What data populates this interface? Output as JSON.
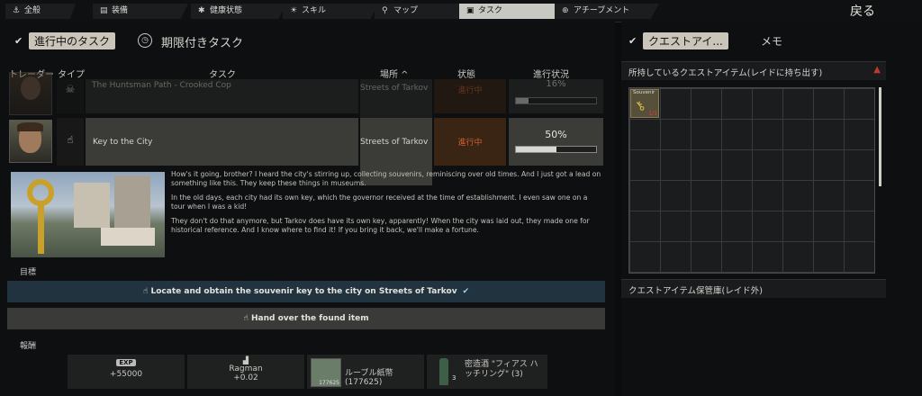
{
  "nav": {
    "tabs": [
      {
        "label": "全般",
        "icon": "anchor-icon"
      },
      {
        "label": "装備",
        "icon": "bag-icon"
      },
      {
        "label": "健康状態",
        "icon": "health-icon"
      },
      {
        "label": "スキル",
        "icon": "sun-icon"
      },
      {
        "label": "マップ",
        "icon": "map-pin-icon"
      },
      {
        "label": "タスク",
        "icon": "clipboard-icon"
      },
      {
        "label": "アチーブメント",
        "icon": "plus-circle-icon"
      }
    ],
    "back_label": "戻る"
  },
  "tasks": {
    "active_tab": "進行中のタスク",
    "timed_tab": "期限付きタスク",
    "headers": {
      "trader": "トレーダー",
      "type": "タイプ",
      "task": "タスク",
      "location": "場所 ^",
      "status": "状態",
      "progress": "進行状況"
    },
    "rows": [
      {
        "name": "The Huntsman Path - Crooked Cop",
        "location": "Streets of Tarkov",
        "status": "進行中",
        "progress_text": "16%",
        "progress": 0.16
      },
      {
        "name": "Key to the City",
        "location": "Streets of Tarkov",
        "status": "進行中",
        "progress_text": "50%",
        "progress": 0.5
      }
    ],
    "description": [
      "How's it going, brother? I heard the city's stirring up, collecting souvenirs, reminiscing over old times. And I just got a lead on something like this. They keep these things in museums.",
      "In the old days, each city had its own key, which the governor received at the time of establishment. I even saw one on a tour when I was a kid!",
      "They don't do that anymore, but Tarkov does have its own key, apparently! When the city was laid out, they made one for historical reference. And I know where to find it! If you bring it back, we'll make a fortune."
    ],
    "objectives_label": "目標",
    "objectives": [
      "Locate and obtain the souvenir key to the city on Streets of Tarkov",
      "Hand over the found item"
    ],
    "rewards_label": "報酬",
    "rewards": {
      "exp_badge": "EXP",
      "exp_value": "+55000",
      "trader_name": "Ragman",
      "trader_value": "+0.02",
      "item1_label": "ルーブル紙幣 (177625)",
      "item1_count": "177625",
      "item2_label": "密造酒 \"フィアス ハッチリング\" (3)",
      "item2_count": "3"
    }
  },
  "right": {
    "tab_active": "クエストアイ...",
    "tab_memo": "メモ",
    "section1_title": "所持しているクエストアイテム(レイドに持ち出す)",
    "item_name": "Souvenir",
    "item_count": "1/1",
    "section2_title": "クエストアイテム保管庫(レイド外)"
  },
  "colors": {
    "accent": "#c9c6b9",
    "status_orange": "#d06030",
    "alert_red": "#c0392b",
    "panel_bg": "#0e0f10"
  }
}
